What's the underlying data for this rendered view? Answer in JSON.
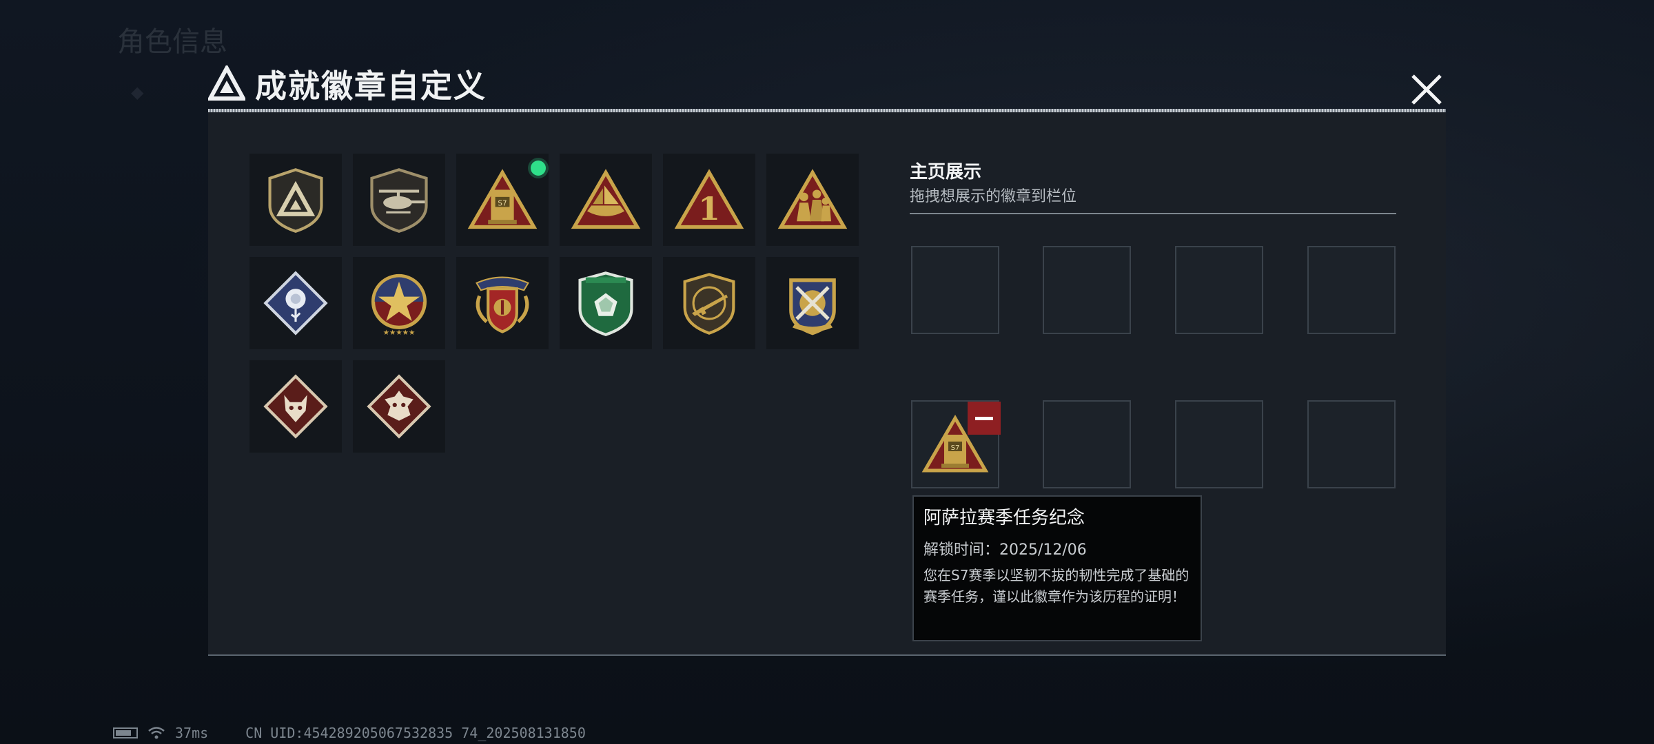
{
  "dialog": {
    "title": "成就徽章自定义",
    "colors": {
      "accent_green": "#2fe08a",
      "remove_red": "#8e1f22",
      "gold": "#c9a44a",
      "maroon": "#7a1d1d"
    }
  },
  "badges": [
    {
      "name": "delta-triangle-shield",
      "new": false
    },
    {
      "name": "helicopter-shield",
      "new": false
    },
    {
      "name": "s7-season-tower",
      "new": true
    },
    {
      "name": "ship-triangle",
      "new": false
    },
    {
      "name": "rank-1-triangle",
      "new": false
    },
    {
      "name": "squad-triangle",
      "new": false
    },
    {
      "name": "rose-diamond",
      "new": false
    },
    {
      "name": "star-compass",
      "new": false
    },
    {
      "name": "winged-crest",
      "new": false
    },
    {
      "name": "green-gem-shield",
      "new": false
    },
    {
      "name": "rifle-shield",
      "new": false
    },
    {
      "name": "crossed-rockets-crest",
      "new": false
    },
    {
      "name": "wolf-diamond",
      "new": false
    },
    {
      "name": "dragon-diamond",
      "new": false
    }
  ],
  "showcase": {
    "title": "主页展示",
    "subtitle": "拖拽想展示的徽章到栏位",
    "filled_slot_badge": "s7-season-tower"
  },
  "tooltip": {
    "name": "阿萨拉赛季任务纪念",
    "unlock_time": "解锁时间：2025/12/06",
    "description": "您在S7赛季以坚韧不拔的韧性完成了基础的赛季任务，谨以此徽章作为该历程的证明！"
  },
  "status_bar": {
    "ping": "37ms",
    "uid": "CN UID:454289205067532835 74_202508131850"
  },
  "background": {
    "ghost_title": "角色信息"
  }
}
